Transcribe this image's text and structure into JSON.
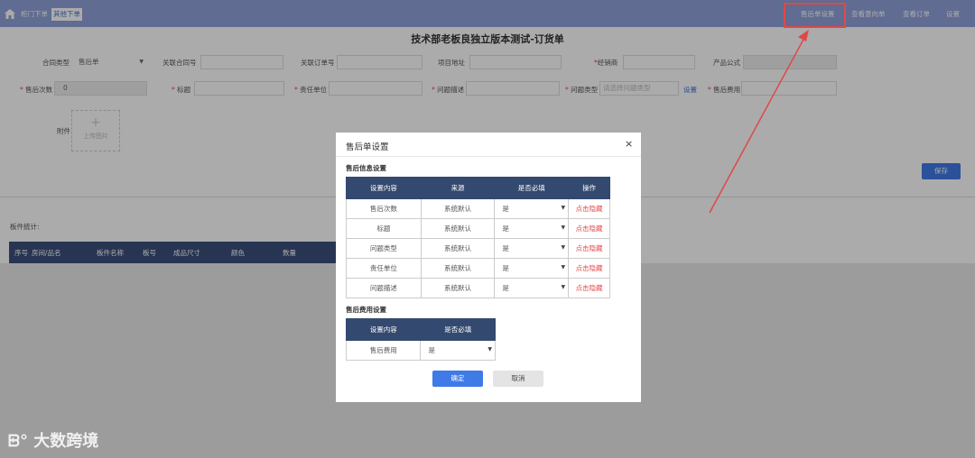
{
  "topbar": {
    "tabs": [
      "柜门下单",
      "其他下单"
    ],
    "nav": [
      "售后单设置",
      "查看意向单",
      "查看订单",
      "设置"
    ]
  },
  "page": {
    "title": "技术部老板良独立版本测试-订货单",
    "row1": {
      "contract_type_label": "合同类型",
      "contract_type_value": "售后单",
      "related_contract_label": "关联合同号",
      "related_order_label": "关联订单号",
      "project_address_label": "项目地址",
      "dealer_label": "经销商",
      "product_formula_label": "产品公式"
    },
    "row2": {
      "after_sales_times_label": "售后次数",
      "after_sales_times_value": "0",
      "title_label": "标题",
      "responsible_unit_label": "责任单位",
      "problem_desc_label": "问题描述",
      "problem_type_label": "问题类型",
      "problem_type_placeholder": "请选择问题类型",
      "settings_link": "设置",
      "after_sales_fee_label": "售后费用"
    },
    "attachment_label": "附件",
    "upload_plus": "+",
    "upload_label": "上传图片",
    "save_label": "保存",
    "board_stats_label": "板件统计:",
    "table_headers": [
      "序号",
      "房间/品名",
      "板件名称",
      "板号",
      "成品尺寸",
      "颜色",
      "数量"
    ]
  },
  "modal": {
    "title": "售后单设置",
    "close": "×",
    "info_section": "售后信息设置",
    "info_headers": [
      "设置内容",
      "来源",
      "是否必填",
      "操作"
    ],
    "info_rows": [
      {
        "name": "售后次数",
        "source": "系统默认",
        "required": "是",
        "action": "点击隐藏"
      },
      {
        "name": "标题",
        "source": "系统默认",
        "required": "是",
        "action": "点击隐藏"
      },
      {
        "name": "问题类型",
        "source": "系统默认",
        "required": "是",
        "action": "点击隐藏"
      },
      {
        "name": "责任单位",
        "source": "系统默认",
        "required": "是",
        "action": "点击隐藏"
      },
      {
        "name": "问题描述",
        "source": "系统默认",
        "required": "是",
        "action": "点击隐藏"
      }
    ],
    "fee_section": "售后费用设置",
    "fee_headers": [
      "设置内容",
      "是否必填"
    ],
    "fee_rows": [
      {
        "name": "售后费用",
        "required": "是"
      }
    ],
    "ok_label": "确定",
    "cancel_label": "取消"
  },
  "watermark": "大数跨境",
  "colors": {
    "topbar": "#8fa2d8",
    "primary": "#3f7ae6",
    "table_header": "#33496f",
    "action_red": "#e84b4b",
    "highlight": "#e04848"
  }
}
